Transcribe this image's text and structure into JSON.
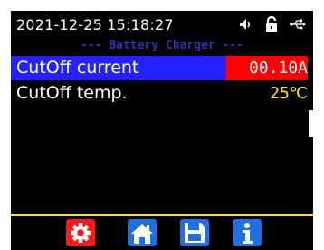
{
  "status": {
    "datetime": "2021-12-25 15:18:27",
    "icons": [
      "speaker-icon",
      "lock-open-icon",
      "usb-icon"
    ]
  },
  "screen": {
    "title": "--- Battery Charger ---",
    "rows": [
      {
        "label": "CutOff current",
        "value": "00.10A",
        "selected": true
      },
      {
        "label": "CutOff temp.",
        "value": "25℃",
        "selected": false
      }
    ]
  },
  "toolbar": {
    "buttons": [
      {
        "icon": "gear-icon",
        "color": "#ff1a1a"
      },
      {
        "icon": "home-icon",
        "color": "#1f6fe0"
      },
      {
        "icon": "save-icon",
        "color": "#1f6fe0"
      },
      {
        "icon": "info-icon",
        "color": "#1f6fe0"
      }
    ]
  },
  "colors": {
    "selected_row": "#2522ff",
    "selected_value_bg": "#ff0000",
    "value_text": "#ffe600",
    "title_text": "#2c36b0",
    "divider": "#ffe600"
  }
}
